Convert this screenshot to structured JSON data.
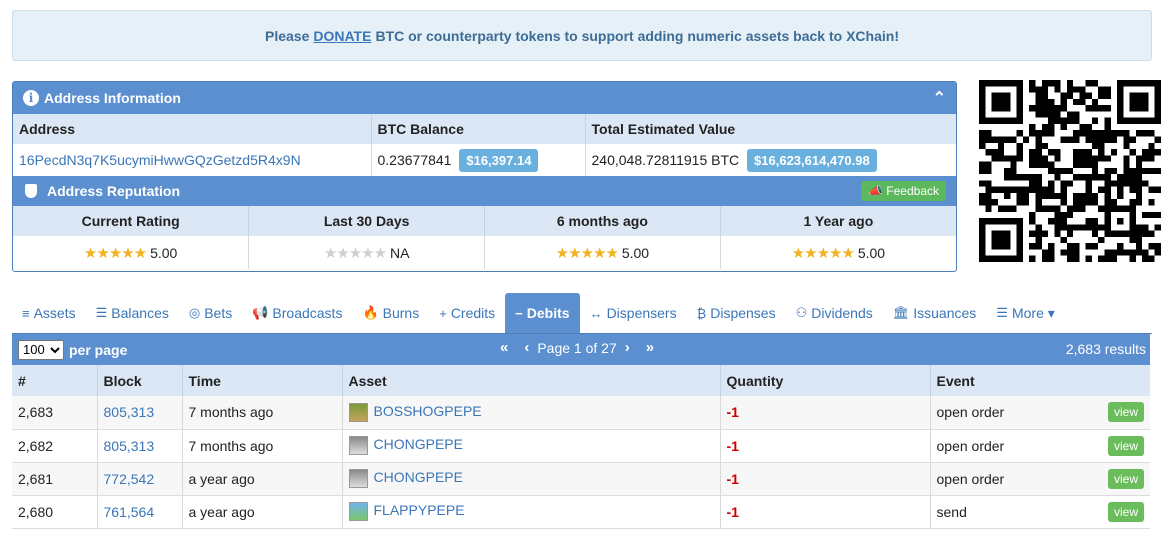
{
  "donate": {
    "prefix": "Please",
    "link": "DONATE",
    "suffix": "BTC or counterparty tokens to support adding numeric assets back to XChain!"
  },
  "address_info": {
    "title": "Address Information",
    "headers": [
      "Address",
      "BTC Balance",
      "Total Estimated Value"
    ],
    "address": "16PecdN3q7K5ucymiHwwGQzGetzd5R4x9N",
    "btc_balance": "0.23677841",
    "btc_usd": "$16,397.14",
    "total_value": "240,048.72811915 BTC",
    "total_usd": "$16,623,614,470.98"
  },
  "reputation": {
    "title": "Address Reputation",
    "feedback_label": "Feedback",
    "headers": [
      "Current Rating",
      "Last 30 Days",
      "6 months ago",
      "1 Year ago"
    ],
    "values": [
      "5.00",
      "NA",
      "5.00",
      "5.00"
    ],
    "stars": [
      "★★★★★",
      "★★★★★",
      "★★★★★",
      "★★★★★"
    ]
  },
  "tabs": [
    {
      "label": "Assets",
      "icon": "≡"
    },
    {
      "label": "Balances",
      "icon": "☰"
    },
    {
      "label": "Bets",
      "icon": "◎"
    },
    {
      "label": "Broadcasts",
      "icon": "📢"
    },
    {
      "label": "Burns",
      "icon": "🔥"
    },
    {
      "label": "Credits",
      "icon": "+"
    },
    {
      "label": "Debits",
      "icon": "−"
    },
    {
      "label": "Dispensers",
      "icon": "↔"
    },
    {
      "label": "Dispenses",
      "icon": "₿"
    },
    {
      "label": "Dividends",
      "icon": "⚇"
    },
    {
      "label": "Issuances",
      "icon": "🏛"
    },
    {
      "label": "More ▾",
      "icon": "☰"
    }
  ],
  "list": {
    "per_page_value": "100",
    "per_page_label": "per page",
    "page_text": "Page 1 of 27",
    "results": "2,683 results"
  },
  "table": {
    "headers": [
      "#",
      "Block",
      "Time",
      "Asset",
      "Quantity",
      "Event"
    ],
    "view_label": "view",
    "rows": [
      {
        "num": "2,683",
        "block": "805,313",
        "time": "7 months ago",
        "asset": "BOSSHOGPEPE",
        "qty": "-1",
        "event": "open order"
      },
      {
        "num": "2,682",
        "block": "805,313",
        "time": "7 months ago",
        "asset": "CHONGPEPE",
        "qty": "-1",
        "event": "open order"
      },
      {
        "num": "2,681",
        "block": "772,542",
        "time": "a year ago",
        "asset": "CHONGPEPE",
        "qty": "-1",
        "event": "open order"
      },
      {
        "num": "2,680",
        "block": "761,564",
        "time": "a year ago",
        "asset": "FLAPPYPEPE",
        "qty": "-1",
        "event": "send"
      }
    ]
  }
}
